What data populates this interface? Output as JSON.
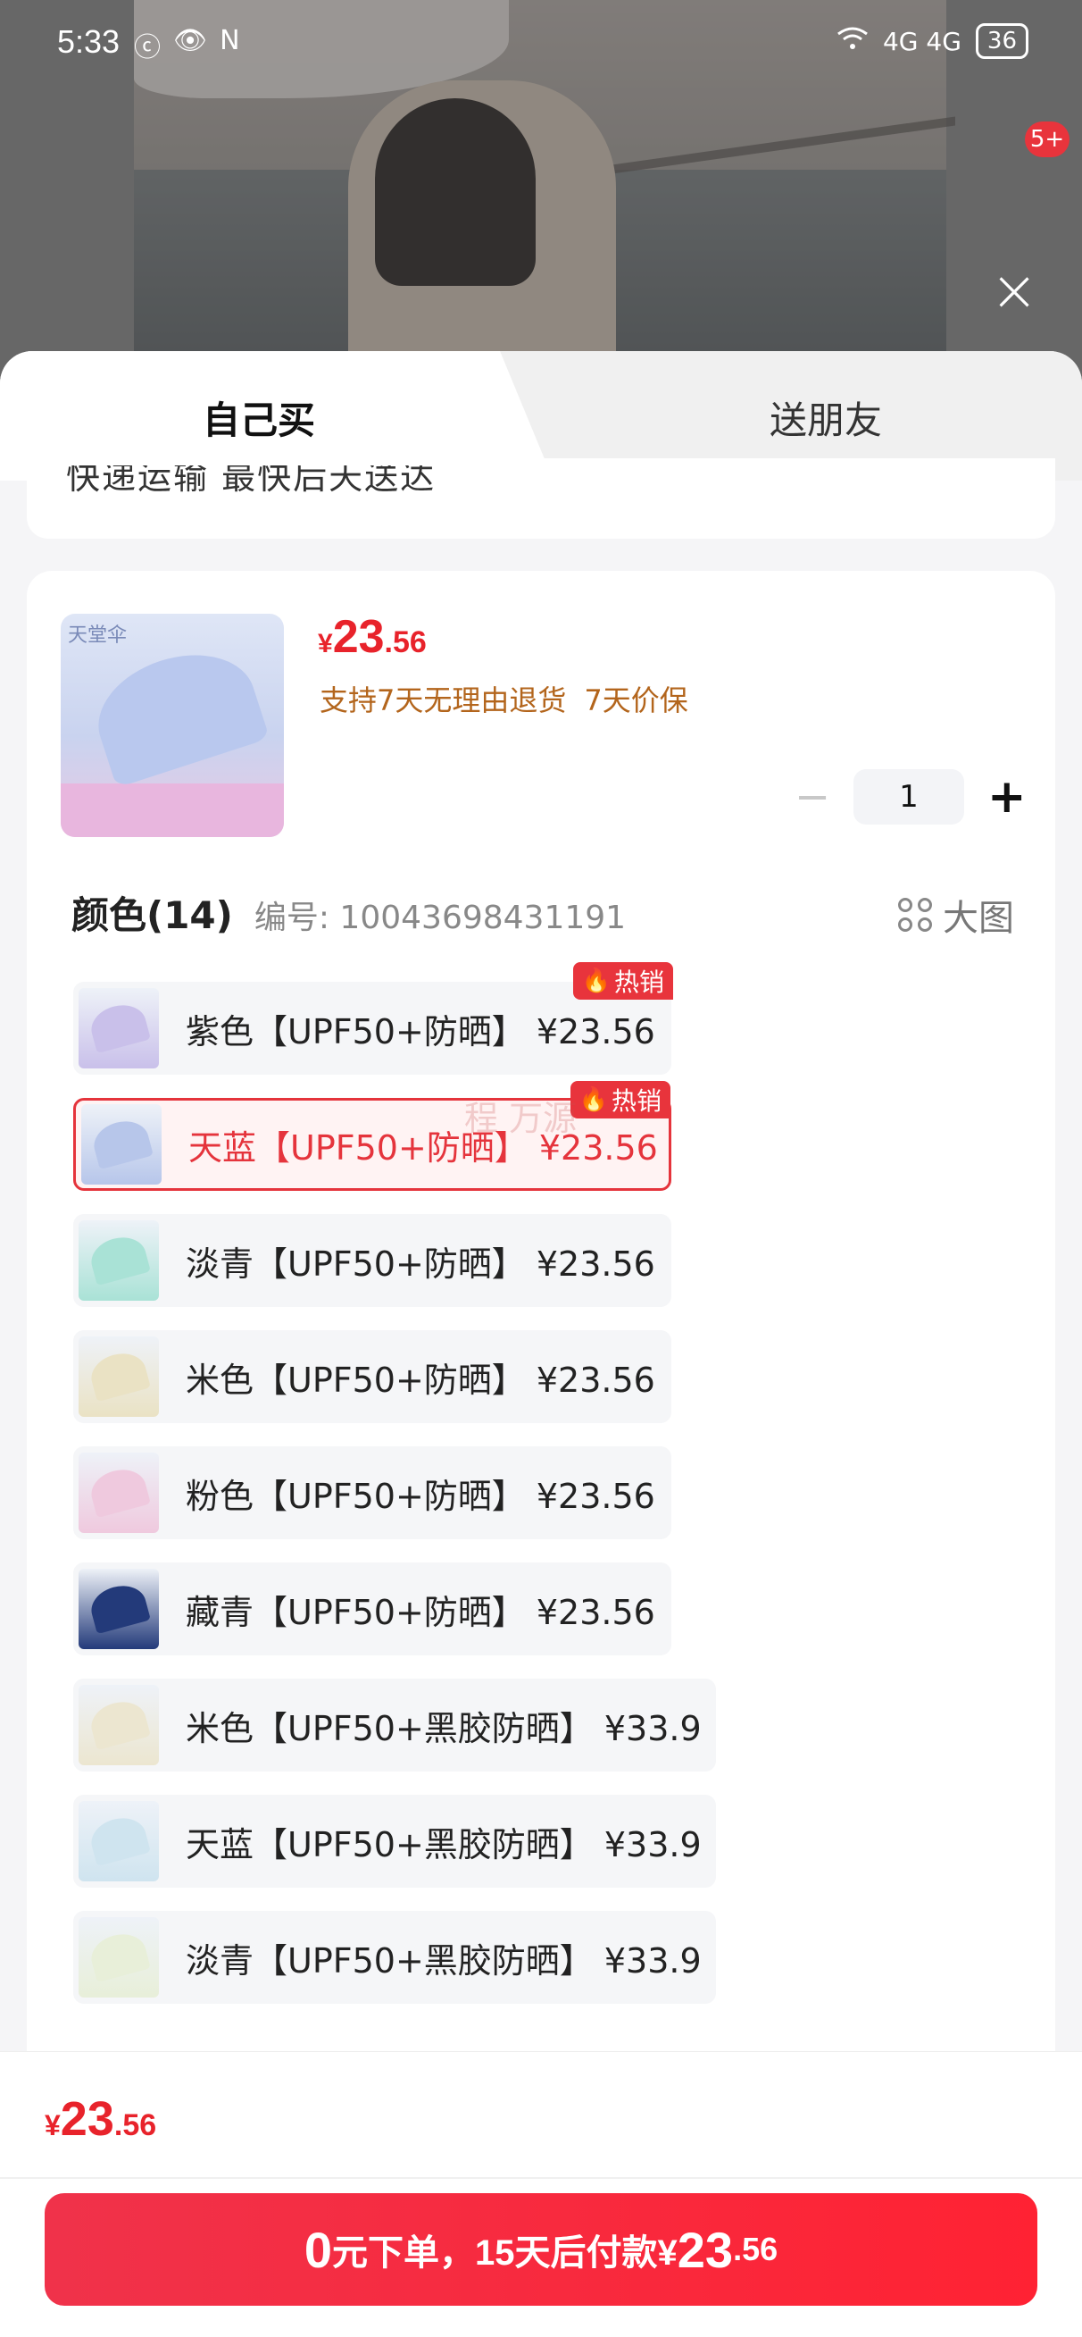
{
  "status_bar": {
    "time": "5:33",
    "icons_left": [
      "ⓒ",
      "👁",
      "N"
    ],
    "signal": "4G 4G",
    "battery": "36"
  },
  "notification_badge": "5+",
  "tabs": {
    "self": "自己买",
    "friend": "送朋友"
  },
  "cut_text": "快递运输 最快后天送达",
  "product": {
    "thumb_brand": "天堂伞",
    "price_currency": "¥",
    "price_int": "23",
    "price_dec": ".56",
    "promise_return": "支持7天无理由退货",
    "promise_price": "7天价保",
    "quantity": "1"
  },
  "spec": {
    "title": "颜色(14)",
    "code": "编号: 10043698431191",
    "big_image": "大图"
  },
  "hot_label": "热销",
  "watermark": "程 万源",
  "options": [
    {
      "label": "紫色【UPF50+防晒】   ¥23.56",
      "hot": true,
      "color": "#c9c0ea"
    },
    {
      "label": "天蓝【UPF50+防晒】   ¥23.56",
      "hot": true,
      "color": "#b7c6ea",
      "selected": true
    },
    {
      "label": "淡青【UPF50+防晒】   ¥23.56",
      "hot": false,
      "color": "#a9e2d6"
    },
    {
      "label": "米色【UPF50+防晒】   ¥23.56",
      "hot": false,
      "color": "#eae2c4"
    },
    {
      "label": "粉色【UPF50+防晒】   ¥23.56",
      "hot": false,
      "color": "#efc9de"
    },
    {
      "label": "藏青【UPF50+防晒】   ¥23.56",
      "hot": false,
      "color": "#233a7a"
    },
    {
      "label": "米色【UPF50+黑胶防晒】   ¥33.9",
      "hot": false,
      "color": "#ece6d0"
    },
    {
      "label": "天蓝【UPF50+黑胶防晒】   ¥33.9",
      "hot": false,
      "color": "#cfe4ef"
    },
    {
      "label": "淡青【UPF50+黑胶防晒】   ¥33.9",
      "hot": false,
      "color": "#e8efd9"
    }
  ],
  "bottom": {
    "price_currency": "¥",
    "price_int": "23",
    "price_dec": ".56",
    "button_zero": "0",
    "button_text": "元下单，15天后付款¥",
    "button_int": "23",
    "button_dec": ".56"
  },
  "colors": {
    "accent_red": "#e8232b",
    "promise_brown": "#b3651c"
  }
}
